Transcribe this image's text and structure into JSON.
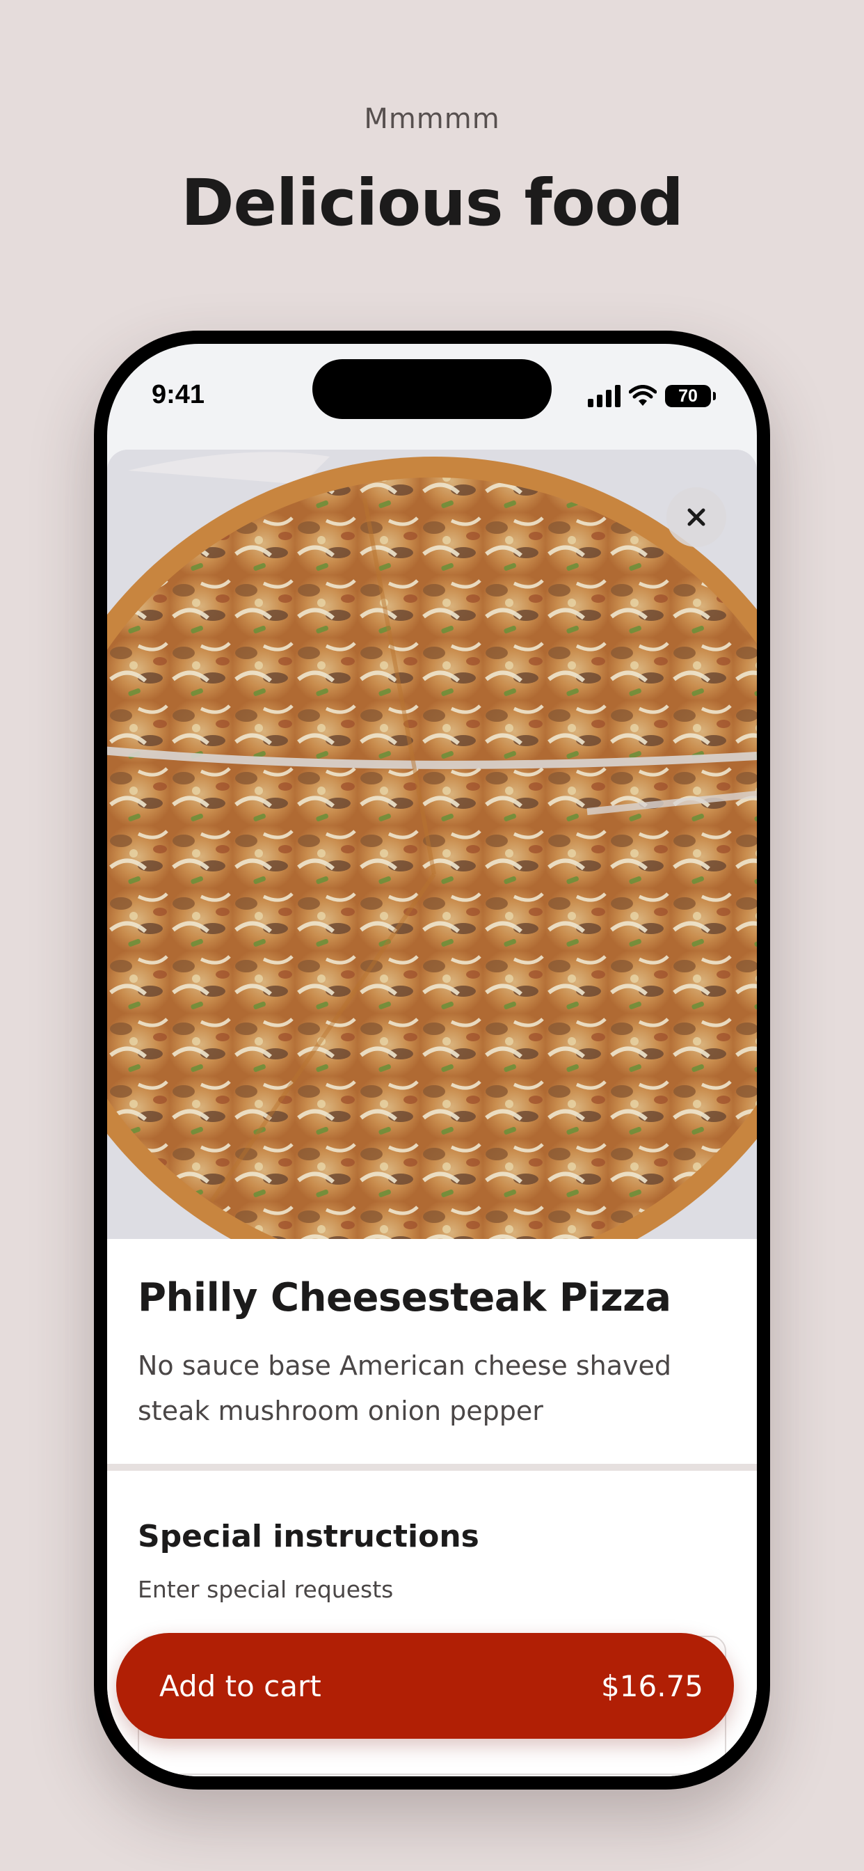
{
  "promo": {
    "subtitle": "Mmmmm",
    "title": "Delicious food"
  },
  "status_bar": {
    "time": "9:41",
    "battery_level": "70",
    "icons": [
      "signal-icon",
      "wifi-icon",
      "battery-icon"
    ]
  },
  "item": {
    "image": "pizza-photo",
    "name": "Philly Cheesesteak Pizza",
    "description": "No sauce base American cheese shaved steak mushroom onion pepper"
  },
  "special_instructions": {
    "title": "Special instructions",
    "hint": "Enter special requests",
    "value": ""
  },
  "cart": {
    "label": "Add to cart",
    "price": "$16.75"
  },
  "colors": {
    "background": "#e5dcdb",
    "accent": "#b11f05",
    "text": "#1c1b1b"
  }
}
